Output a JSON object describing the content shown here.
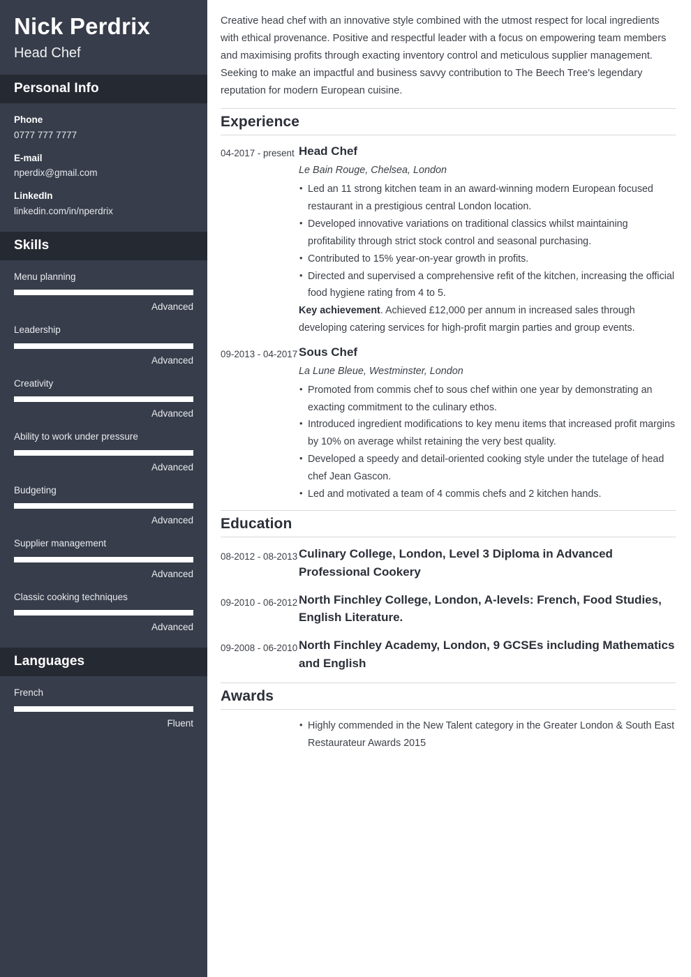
{
  "sidebar": {
    "full_name": "Nick Perdrix",
    "job_title": "Head Chef",
    "personal_info": {
      "heading": "Personal Info",
      "items": [
        {
          "label": "Phone",
          "value": "0777 777 7777"
        },
        {
          "label": "E-mail",
          "value": "nperdix@gmail.com"
        },
        {
          "label": "LinkedIn",
          "value": "linkedin.com/in/nperdrix"
        }
      ]
    },
    "skills": {
      "heading": "Skills",
      "items": [
        {
          "name": "Menu planning",
          "level": "Advanced",
          "percent": 100
        },
        {
          "name": "Leadership",
          "level": "Advanced",
          "percent": 100
        },
        {
          "name": "Creativity",
          "level": "Advanced",
          "percent": 100
        },
        {
          "name": "Ability to work under pressure",
          "level": "Advanced",
          "percent": 100
        },
        {
          "name": "Budgeting",
          "level": "Advanced",
          "percent": 100
        },
        {
          "name": "Supplier management",
          "level": "Advanced",
          "percent": 100
        },
        {
          "name": "Classic cooking techniques",
          "level": "Advanced",
          "percent": 100
        }
      ]
    },
    "languages": {
      "heading": "Languages",
      "items": [
        {
          "name": "French",
          "level": "Fluent",
          "percent": 100
        }
      ]
    }
  },
  "main": {
    "summary": "Creative head chef with an innovative style combined with the utmost respect for local ingredients with ethical provenance. Positive and respectful leader with a focus on empowering team members and maximising profits through exacting inventory control and meticulous supplier management. Seeking to make an impactful and business savvy contribution to The Beech Tree's legendary reputation for modern European cuisine.",
    "experience": {
      "heading": "Experience",
      "entries": [
        {
          "date": "04-2017 - present",
          "title": "Head Chef",
          "subtitle": "Le Bain Rouge, Chelsea, London",
          "bullets": [
            "Led an 11 strong kitchen team in an award-winning modern European focused restaurant in a prestigious central London location.",
            "Developed innovative variations on traditional classics whilst maintaining profitability through strict stock control and seasonal purchasing.",
            "Contributed to 15% year-on-year growth in profits.",
            "Directed and supervised a comprehensive refit of the kitchen, increasing the official food hygiene rating from 4 to 5."
          ],
          "key_achievement_label": "Key achievement",
          "key_achievement_text": ". Achieved £12,000 per annum in increased sales through developing catering services for high-profit margin parties and group events."
        },
        {
          "date": "09-2013 - 04-2017",
          "title": "Sous Chef",
          "subtitle": "La Lune Bleue, Westminster, London",
          "bullets": [
            "Promoted from commis chef to sous chef within one year by demonstrating an exacting commitment to the culinary ethos.",
            "Introduced ingredient modifications to key menu items that increased profit margins by 10% on average whilst retaining the very best quality.",
            "Developed a speedy and detail-oriented cooking style under the tutelage of head chef Jean Gascon.",
            "Led and motivated a team of 4 commis chefs and 2 kitchen hands."
          ]
        }
      ]
    },
    "education": {
      "heading": "Education",
      "entries": [
        {
          "date": "08-2012 - 08-2013",
          "title": "Culinary College, London, Level 3 Diploma in Advanced Professional Cookery"
        },
        {
          "date": "09-2010 - 06-2012",
          "title": "North Finchley College, London, A-levels: French, Food Studies, English Literature."
        },
        {
          "date": "09-2008 - 06-2010",
          "title": "North Finchley Academy, London, 9 GCSEs including Mathematics and English"
        }
      ]
    },
    "awards": {
      "heading": "Awards",
      "bullets": [
        "Highly commended in the New Talent category in the Greater London & South East Restaurateur Awards 2015"
      ]
    }
  },
  "colors": {
    "sidebar_bg": "#373d4a",
    "sidebar_band_bg": "#252932",
    "bar_fill": "#ffffff",
    "text_dark": "#2b2f38",
    "divider": "#d9d9d9"
  }
}
